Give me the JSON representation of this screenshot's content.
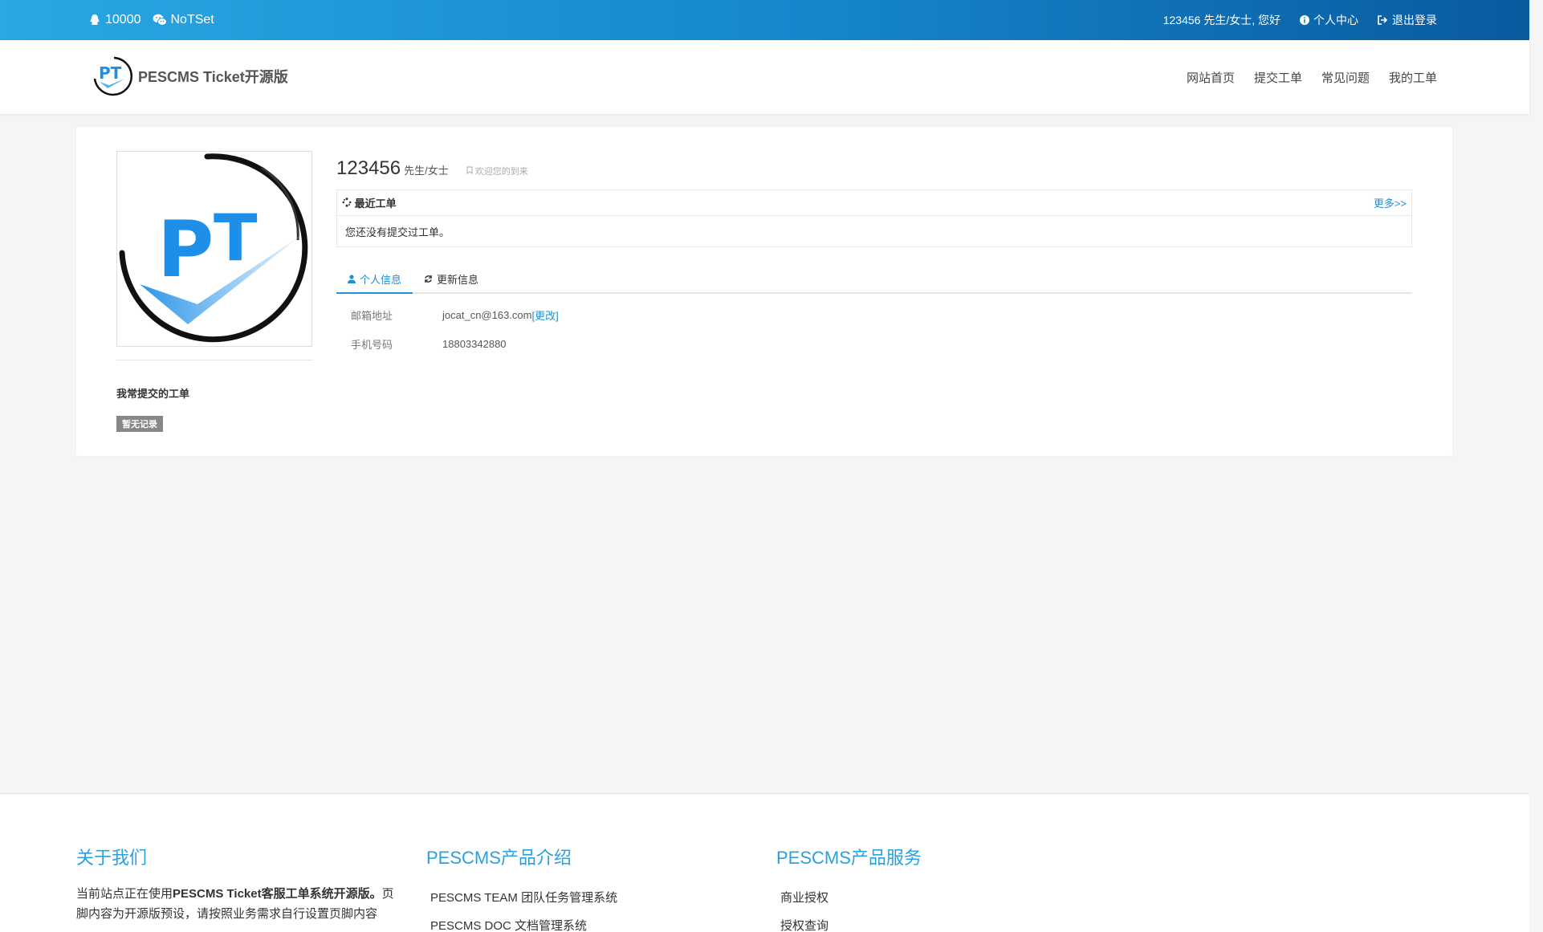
{
  "topbar": {
    "qq": "10000",
    "wechat": "NoTSet",
    "greeting": "123456 先生/女士, 您好",
    "user_center": "个人中心",
    "logout": "退出登录"
  },
  "header": {
    "logo_text": "PESCMS Ticket开源版",
    "nav": [
      "网站首页",
      "提交工单",
      "常见问题",
      "我的工单"
    ]
  },
  "sidebar": {
    "title": "我常提交的工单",
    "badge": "暂无记录"
  },
  "profile": {
    "name": "123456",
    "suffix": "先生/女士",
    "welcome": "欢迎您的到来"
  },
  "recent": {
    "title": "最近工单",
    "more": "更多>>",
    "empty": "您还没有提交过工单。"
  },
  "tabs": [
    {
      "label": "个人信息",
      "active": true
    },
    {
      "label": "更新信息",
      "active": false
    }
  ],
  "info": {
    "email_label": "邮箱地址",
    "email_value": "jocat_cn@163.com",
    "email_change": "[更改]",
    "phone_label": "手机号码",
    "phone_value": "18803342880"
  },
  "footer": {
    "about_title": "关于我们",
    "about_text_prefix": "当前站点正在使用",
    "about_text_bold": "PESCMS Ticket客服工单系统开源版。",
    "about_text_rest": "页脚内容为开源版预设，请按照业务需求自行设置页脚内容",
    "products_title": "PESCMS产品介绍",
    "products": [
      "PESCMS TEAM 团队任务管理系统",
      "PESCMS DOC 文档管理系统"
    ],
    "services_title": "PESCMS产品服务",
    "services": [
      "商业授权",
      "授权查询"
    ]
  },
  "colors": {
    "accent": "#1e90d6",
    "topbar_start": "#2aa7e4",
    "topbar_end": "#0a5a9e"
  }
}
